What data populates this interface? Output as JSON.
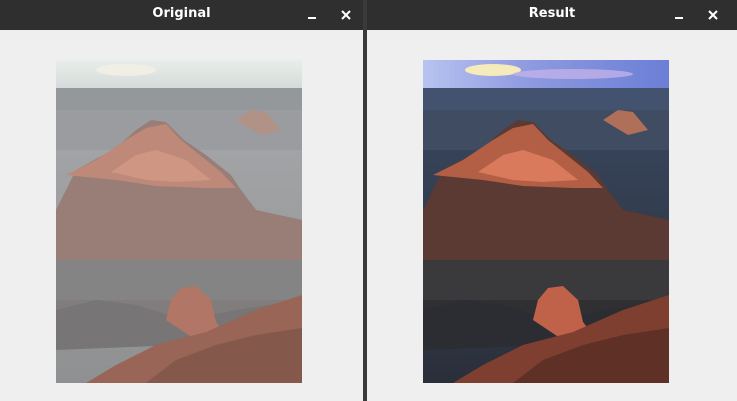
{
  "windows": {
    "original": {
      "title": "Original",
      "minimize_icon": "minimize-icon",
      "close_icon": "close-icon"
    },
    "result": {
      "title": "Result",
      "minimize_icon": "minimize-icon",
      "close_icon": "close-icon"
    }
  },
  "colors": {
    "titlebar": "#2f2f2f",
    "window_bg": "#efefef",
    "title_text": "#ffffff"
  }
}
